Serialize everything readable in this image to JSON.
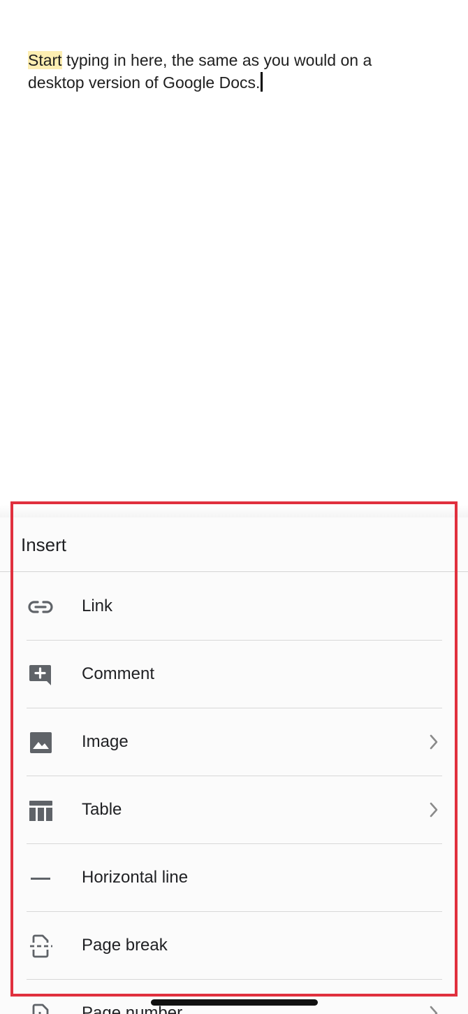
{
  "document": {
    "highlighted_word": "Start",
    "body_text": " typing in here, the same as you would on a desktop version of Google Docs."
  },
  "insert_sheet": {
    "title": "Insert",
    "items": [
      {
        "label": "Link",
        "icon": "link-icon",
        "has_submenu": false
      },
      {
        "label": "Comment",
        "icon": "comment-add-icon",
        "has_submenu": false
      },
      {
        "label": "Image",
        "icon": "image-icon",
        "has_submenu": true
      },
      {
        "label": "Table",
        "icon": "table-icon",
        "has_submenu": true
      },
      {
        "label": "Horizontal line",
        "icon": "horizontal-line-icon",
        "has_submenu": false
      },
      {
        "label": "Page break",
        "icon": "page-break-icon",
        "has_submenu": false
      },
      {
        "label": "Page number",
        "icon": "page-number-icon",
        "has_submenu": true
      }
    ]
  },
  "colors": {
    "highlight": "#fdeeb2",
    "annotation_border": "#e0303e",
    "icon_gray": "#5f6368"
  }
}
